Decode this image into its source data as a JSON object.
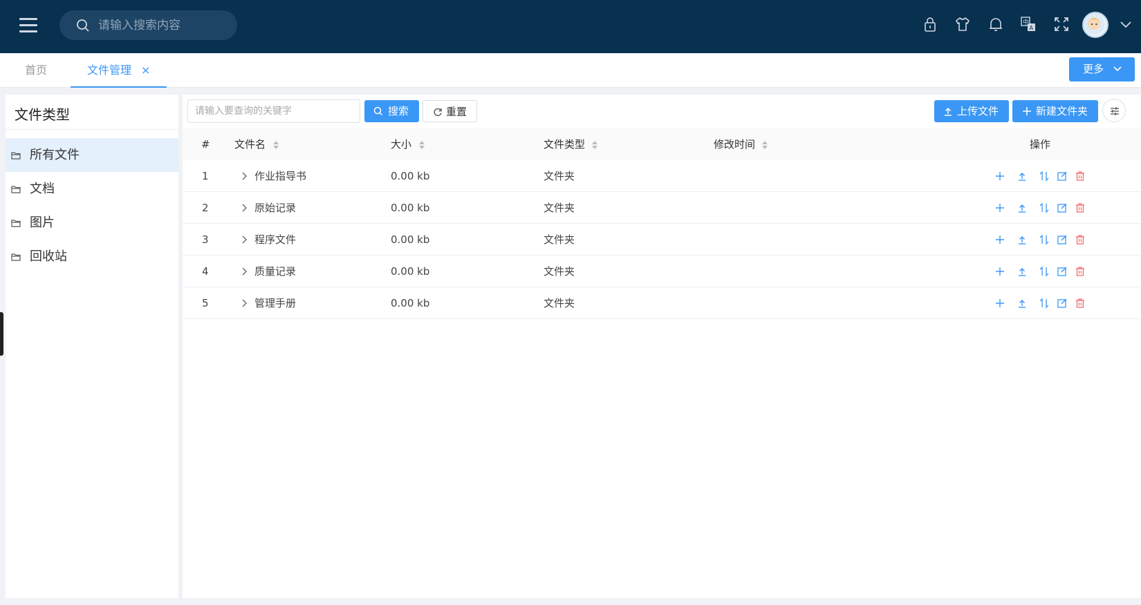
{
  "header": {
    "search_placeholder": "请输入搜索内容",
    "icons": [
      "lock-icon",
      "shirt-icon",
      "bell-icon",
      "translate-icon",
      "fullscreen-icon"
    ]
  },
  "tabs": {
    "home": "首页",
    "active": "文件管理",
    "more": "更多"
  },
  "left": {
    "title": "文件类型",
    "items": [
      "所有文件",
      "文档",
      "图片",
      "回收站"
    ],
    "active_index": 0
  },
  "toolbar": {
    "keyword_placeholder": "请输入要查询的关键字",
    "search": "搜索",
    "reset": "重置",
    "upload": "上传文件",
    "new_folder": "新建文件夹"
  },
  "table": {
    "columns": {
      "index": "#",
      "name": "文件名",
      "size": "大小",
      "type": "文件类型",
      "modified": "修改时间",
      "actions": "操作"
    },
    "rows": [
      {
        "index": "1",
        "name": "作业指导书",
        "size": "0.00 kb",
        "type": "文件夹",
        "modified": ""
      },
      {
        "index": "2",
        "name": "原始记录",
        "size": "0.00 kb",
        "type": "文件夹",
        "modified": ""
      },
      {
        "index": "3",
        "name": "程序文件",
        "size": "0.00 kb",
        "type": "文件夹",
        "modified": ""
      },
      {
        "index": "4",
        "name": "质量记录",
        "size": "0.00 kb",
        "type": "文件夹",
        "modified": ""
      },
      {
        "index": "5",
        "name": "管理手册",
        "size": "0.00 kb",
        "type": "文件夹",
        "modified": ""
      }
    ]
  },
  "colors": {
    "header_bg": "#08304f",
    "accent": "#3a97f5",
    "danger": "#f56c6c"
  }
}
